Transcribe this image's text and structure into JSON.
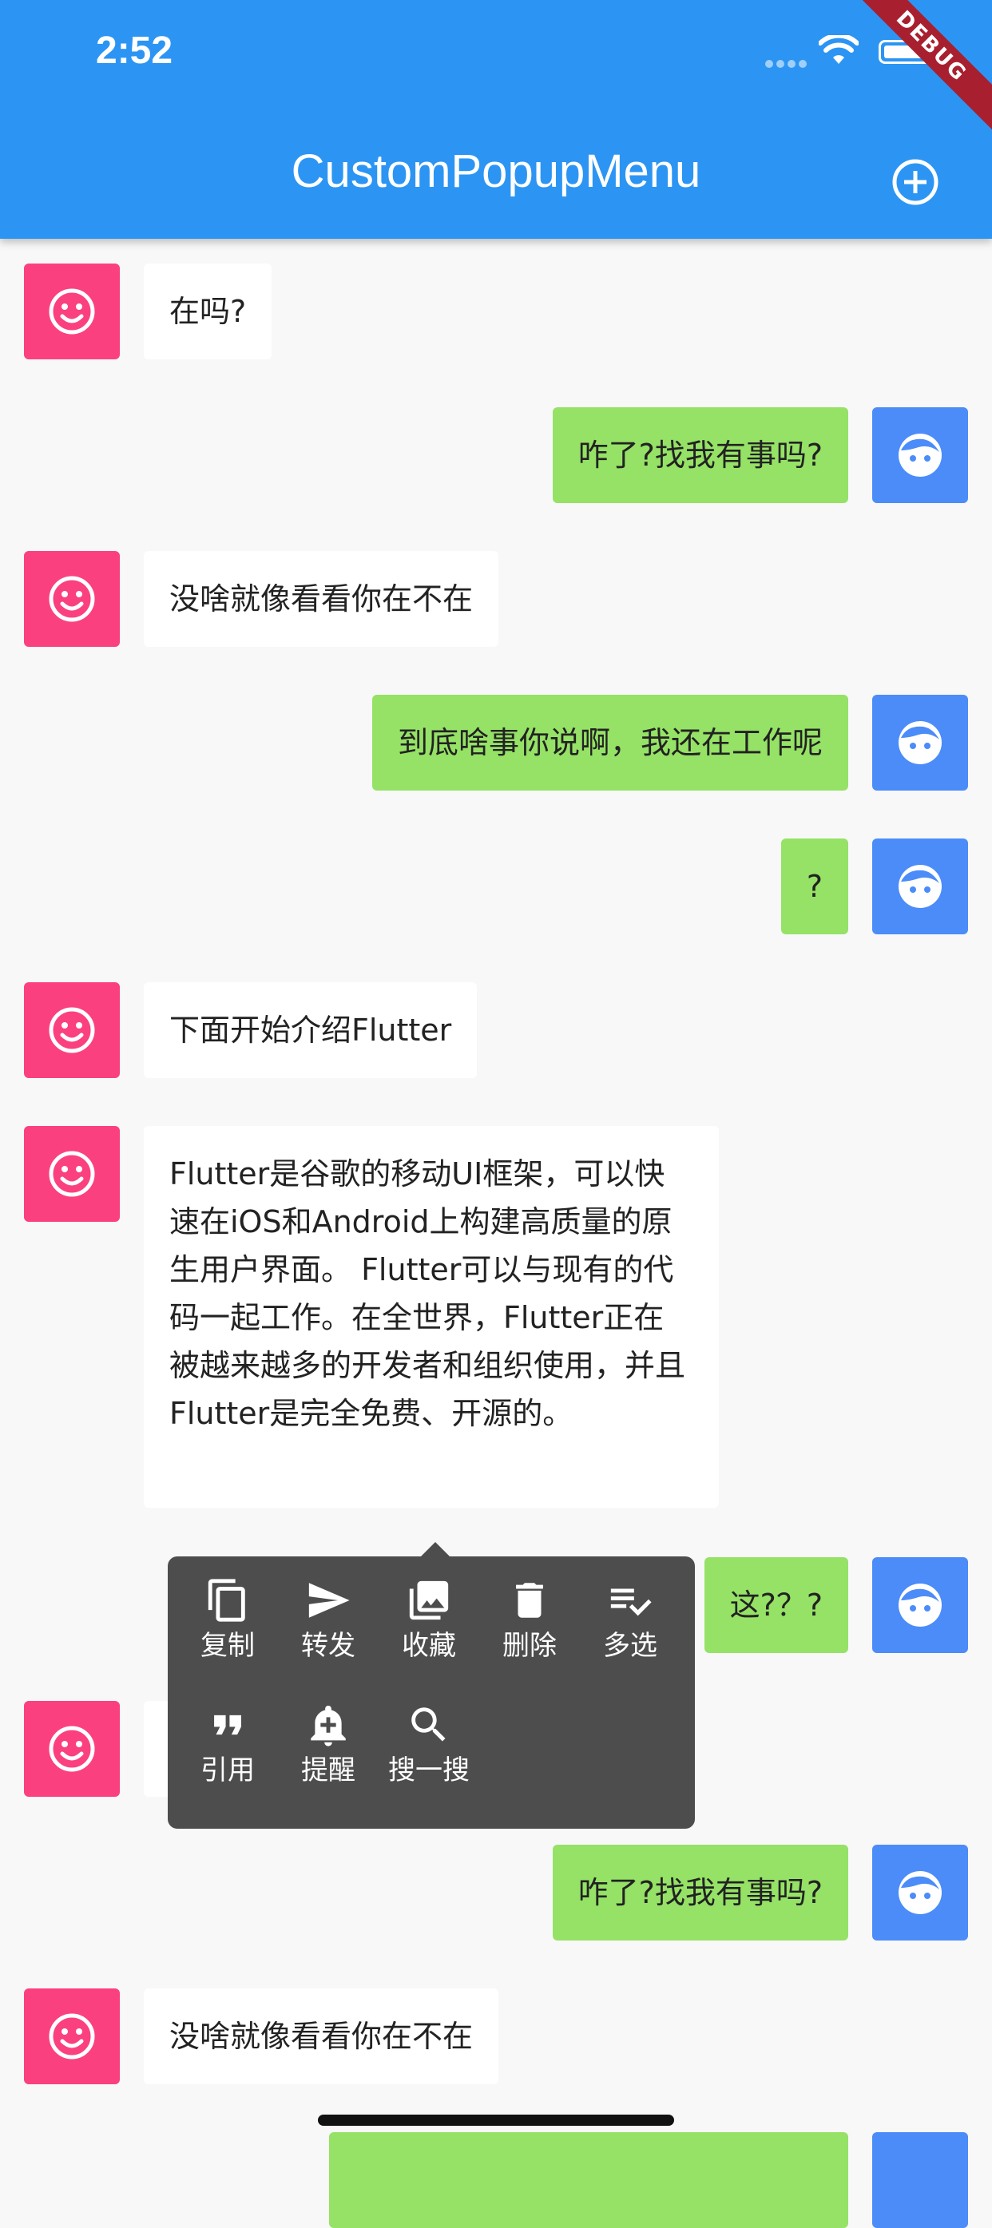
{
  "status_bar": {
    "time": "2:52"
  },
  "debug_banner": "DEBUG",
  "app_bar": {
    "title": "CustomPopupMenu",
    "action_icon": "add-circle-icon"
  },
  "colors": {
    "app_bar": "#2c95f3",
    "left_avatar": "#fb4080",
    "right_avatar": "#4b8cf9",
    "right_bubble": "#95e266",
    "menu_bg": "#4d4d4d"
  },
  "messages": [
    {
      "side": "left",
      "text": "在吗?"
    },
    {
      "side": "right",
      "text": "咋了?找我有事吗?"
    },
    {
      "side": "left",
      "text": "没啥就像看看你在不在"
    },
    {
      "side": "right",
      "text": "到底啥事你说啊，我还在工作呢"
    },
    {
      "side": "right",
      "text": "?"
    },
    {
      "side": "left",
      "text": "下面开始介绍Flutter"
    },
    {
      "side": "left",
      "text": "Flutter是谷歌的移动UI框架，可以快速在iOS和Android上构建高质量的原生用户界面。 Flutter可以与现有的代码一起工作。在全世界，Flutter正在被越来越多的开发者和组织使用，并且Flutter是完全免费、开源的。"
    },
    {
      "side": "right",
      "text": "这?？?"
    },
    {
      "side": "left",
      "text": ""
    },
    {
      "side": "right",
      "text": "咋了?找我有事吗?"
    },
    {
      "side": "left",
      "text": "没啥就像看看你在不在"
    }
  ],
  "popup_menu": {
    "items": [
      {
        "label": "复制",
        "icon": "copy-icon"
      },
      {
        "label": "转发",
        "icon": "send-icon"
      },
      {
        "label": "收藏",
        "icon": "collections-icon"
      },
      {
        "label": "删除",
        "icon": "delete-icon"
      },
      {
        "label": "多选",
        "icon": "playlist-check-icon"
      },
      {
        "label": "引用",
        "icon": "format-quote-icon"
      },
      {
        "label": "提醒",
        "icon": "add-alert-icon"
      },
      {
        "label": "搜一搜",
        "icon": "search-icon"
      }
    ]
  }
}
